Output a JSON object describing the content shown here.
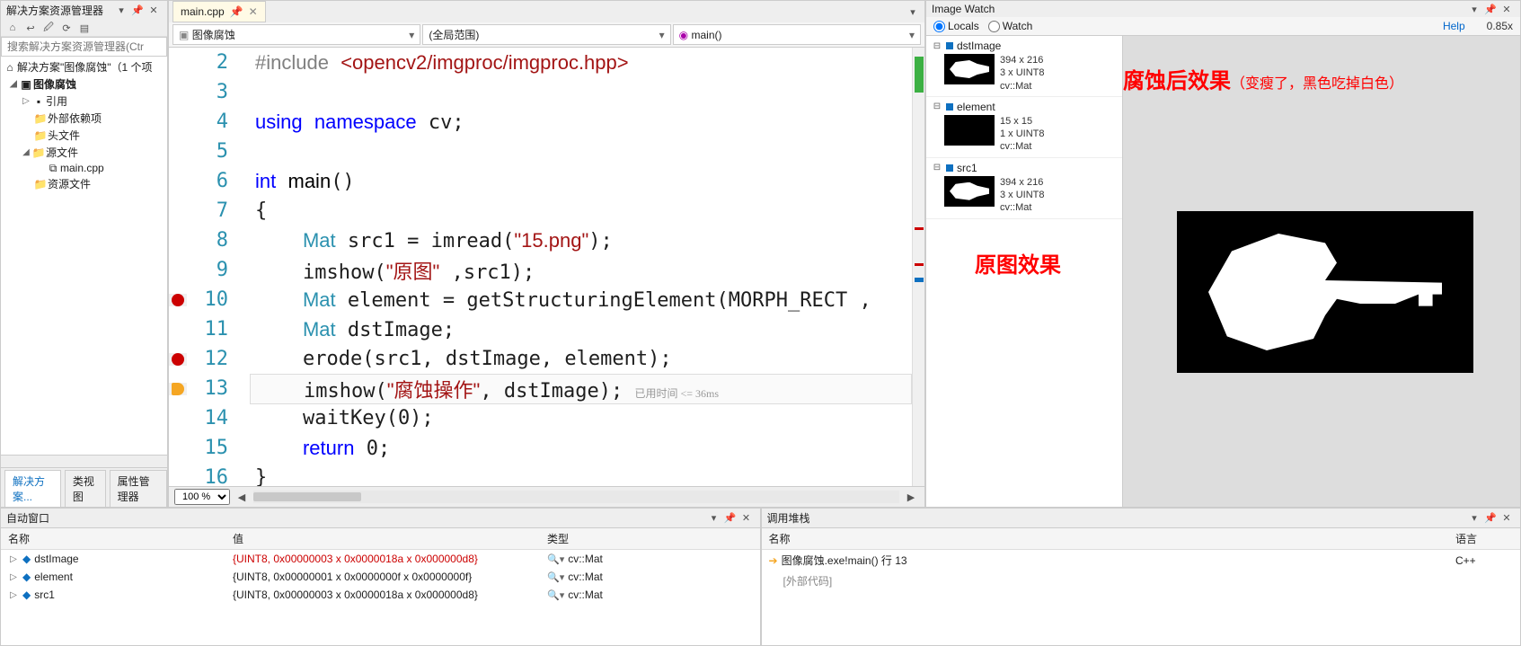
{
  "solution_explorer": {
    "title": "解决方案资源管理器",
    "search_placeholder": "搜索解决方案资源管理器(Ctr",
    "root": "解决方案\"图像腐蚀\"（1 个项",
    "project": "图像腐蚀",
    "nodes": {
      "refs": "引用",
      "ext": "外部依赖项",
      "hdr": "头文件",
      "src": "源文件",
      "main": "main.cpp",
      "res": "资源文件"
    },
    "tabs": {
      "sln": "解决方案...",
      "cls": "类视图",
      "prop": "属性管理器"
    }
  },
  "editor": {
    "tab": "main.cpp",
    "dropdowns": {
      "left": "图像腐蚀",
      "mid": "(全局范围)",
      "right": "main()"
    },
    "zoom": "100 %",
    "lines": [
      {
        "n": 2,
        "html": "<span class='pp'>#include</span> <span class='inc'>&lt;opencv2/imgproc/imgproc.hpp&gt;</span>"
      },
      {
        "n": 3,
        "html": ""
      },
      {
        "n": 4,
        "html": "<span class='kw'>using</span> <span class='kw'>namespace</span> cv;"
      },
      {
        "n": 5,
        "html": ""
      },
      {
        "n": 6,
        "html": "<span class='kw'>int</span> <span class='fn'>main</span>()"
      },
      {
        "n": 7,
        "html": "{"
      },
      {
        "n": 8,
        "html": "    <span class='typ'>Mat</span> src1 = imread(<span class='str'>\"15.png\"</span>);"
      },
      {
        "n": 9,
        "html": "    imshow(<span class='str'>\"原图\"</span> ,src1);"
      },
      {
        "n": 10,
        "html": "    <span class='typ'>Mat</span> element = getStructuringElement(MORPH_RECT ,"
      },
      {
        "n": 11,
        "html": "    <span class='typ'>Mat</span> dstImage;"
      },
      {
        "n": 12,
        "html": "    erode(src1, dstImage, element);"
      },
      {
        "n": 13,
        "html": "    imshow(<span class='str'>\"腐蚀操作\"</span>, dstImage); <span class='inl'>已用时间 &lt;= 36ms</span>",
        "cur": true
      },
      {
        "n": 14,
        "html": "    waitKey(0);"
      },
      {
        "n": 15,
        "html": "    <span class='kw'>return</span> 0;"
      },
      {
        "n": 16,
        "html": "}"
      }
    ],
    "breakpoints": {
      "10": "red",
      "12": "red",
      "13": "arrow"
    }
  },
  "image_watch": {
    "title": "Image Watch",
    "locals": "Locals",
    "watch": "Watch",
    "help": "Help",
    "zoom": "0.85x",
    "items": [
      {
        "name": "dstImage",
        "dim": "394 x 216",
        "fmt": "3 x UINT8",
        "type": "cv::Mat",
        "thumb": "key"
      },
      {
        "name": "element",
        "dim": "15 x 15",
        "fmt": "1 x UINT8",
        "type": "cv::Mat",
        "thumb": "blank"
      },
      {
        "name": "src1",
        "dim": "394 x 216",
        "fmt": "3 x UINT8",
        "type": "cv::Mat",
        "thumb": "key"
      }
    ],
    "anno1": "腐蚀后效果",
    "anno1b": "（变瘦了，黑色吃掉白色）",
    "anno2": "原图效果"
  },
  "autos": {
    "title": "自动窗口",
    "cols": {
      "name": "名称",
      "value": "值",
      "type": "类型"
    },
    "rows": [
      {
        "name": "dstImage",
        "value": "{UINT8, 0x00000003 x 0x0000018a x 0x000000d8}",
        "type": "cv::Mat",
        "red": true
      },
      {
        "name": "element",
        "value": "{UINT8, 0x00000001 x 0x0000000f x 0x0000000f}",
        "type": "cv::Mat"
      },
      {
        "name": "src1",
        "value": "{UINT8, 0x00000003 x 0x0000018a x 0x000000d8}",
        "type": "cv::Mat"
      }
    ]
  },
  "callstack": {
    "title": "调用堆栈",
    "cols": {
      "name": "名称",
      "lang": "语言"
    },
    "rows": [
      {
        "name": "图像腐蚀.exe!main() 行 13",
        "lang": "C++",
        "cur": true
      },
      {
        "name": "[外部代码]",
        "lang": "",
        "ext": true
      }
    ]
  }
}
